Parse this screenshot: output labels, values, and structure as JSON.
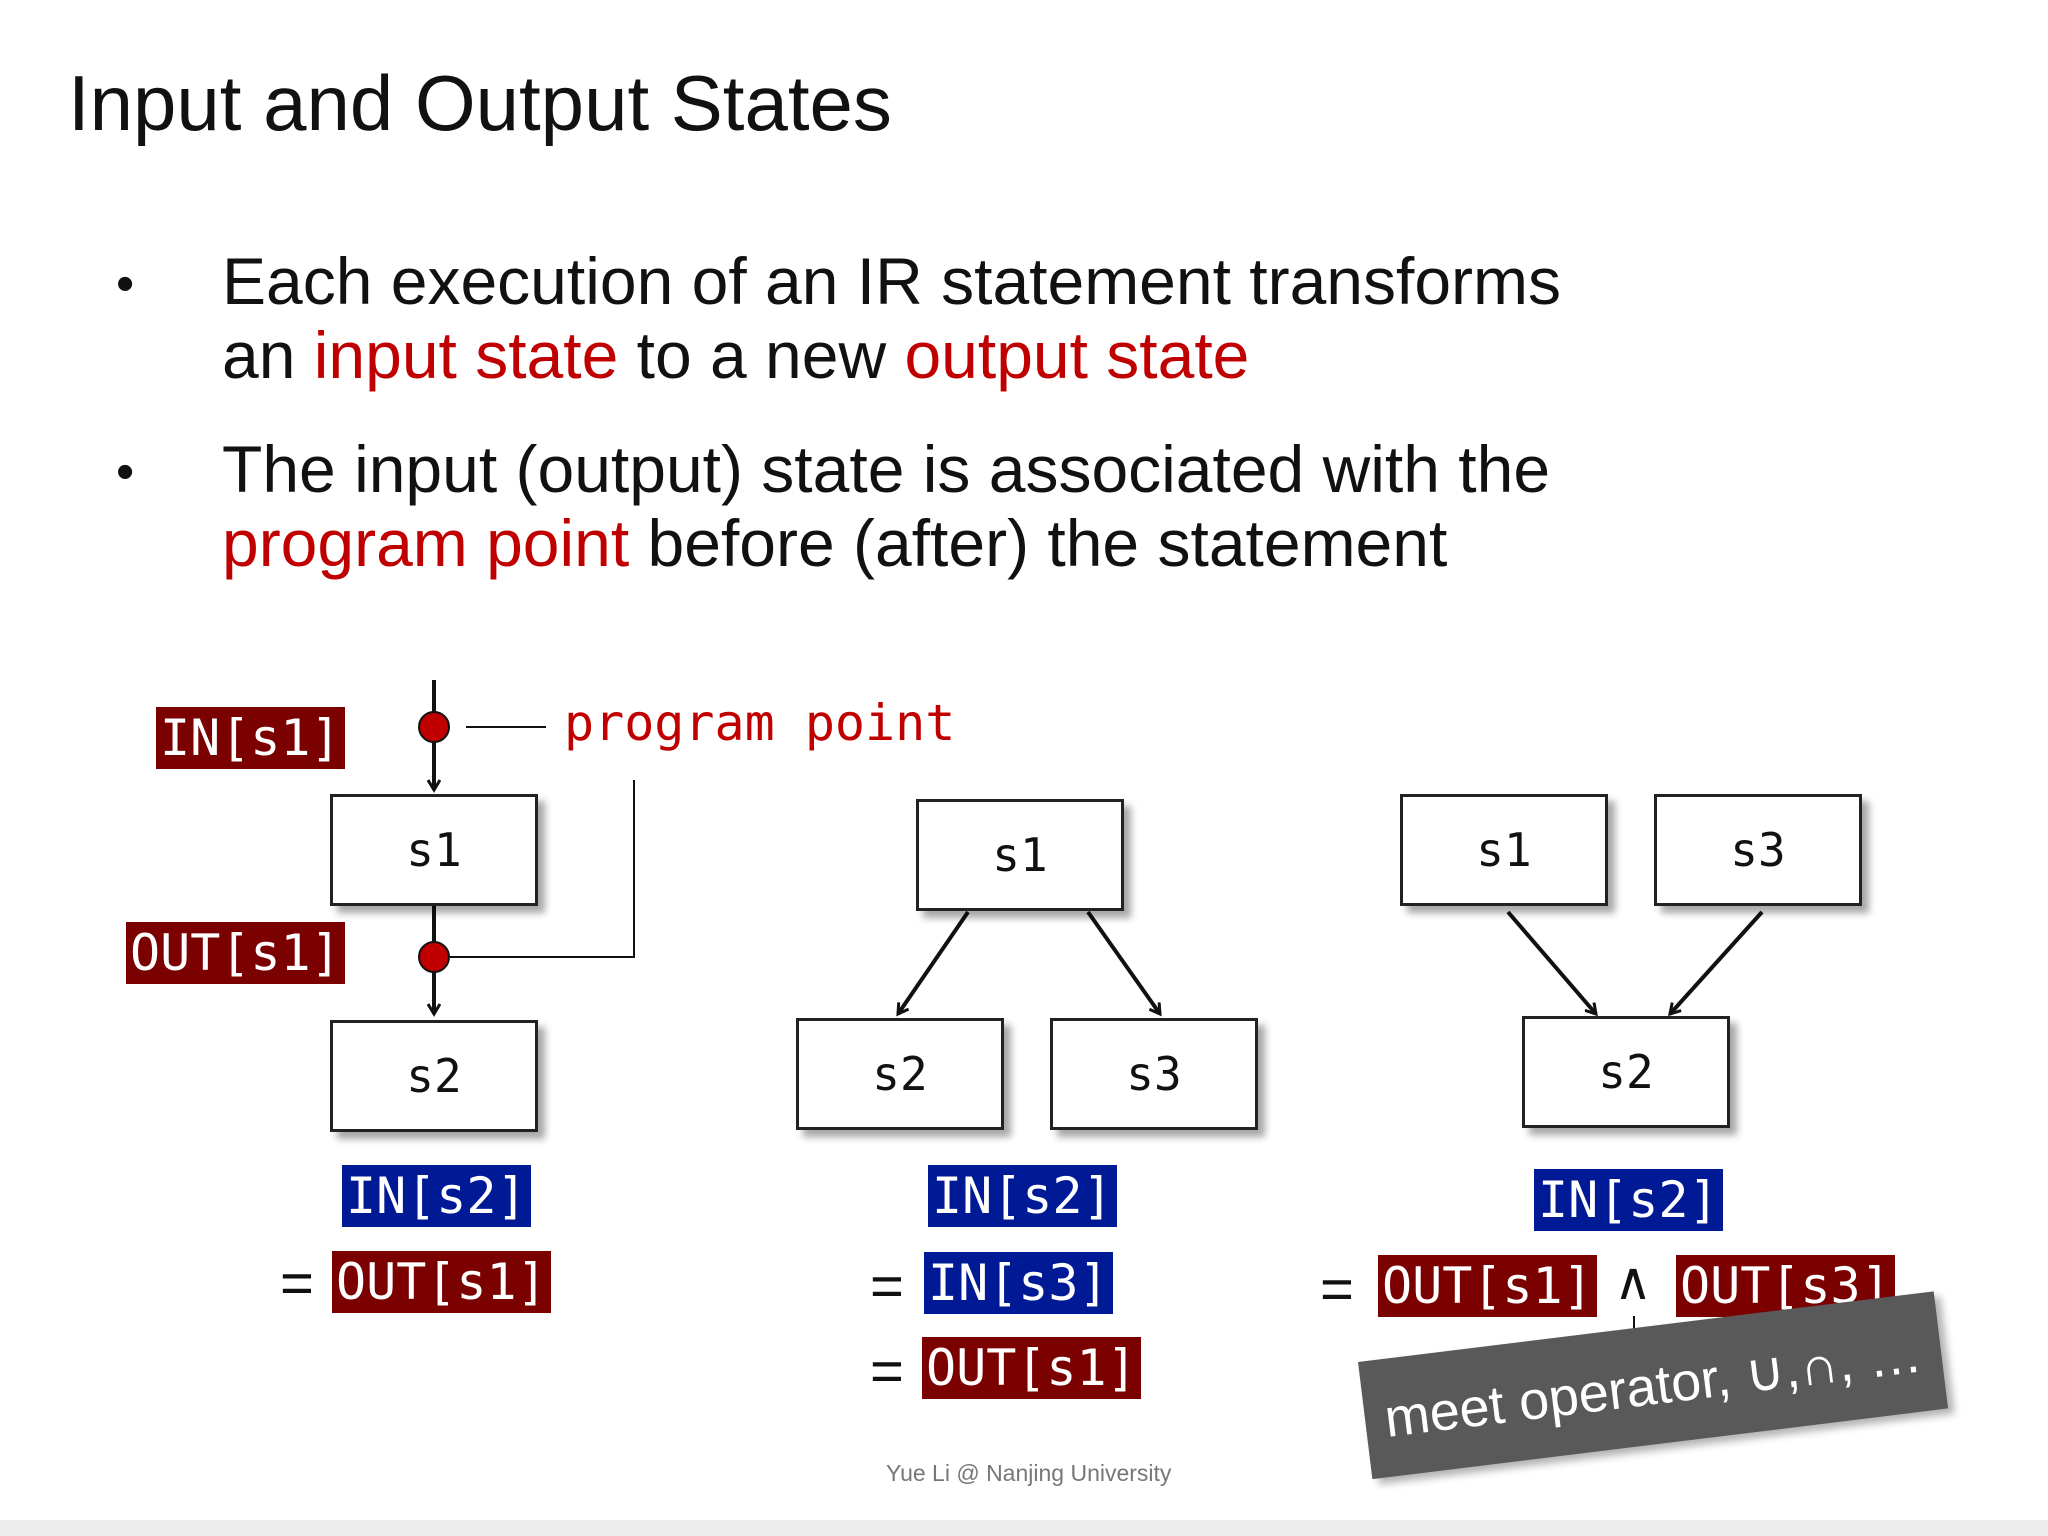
{
  "title": "Input and Output States",
  "bullets": [
    {
      "symbol": "•",
      "line1": "Each execution of an IR statement transforms",
      "line2_prefix": "an ",
      "line2_red1": "input state",
      "line2_mid": " to a new ",
      "line2_red2": "output state"
    },
    {
      "symbol": "•",
      "line1": "The input (output) state is associated with the",
      "line2_red": "program point",
      "line2_rest": " before (after) the statement"
    }
  ],
  "diagram_left": {
    "in_label": "IN[s1]",
    "out_label": "OUT[s1]",
    "program_point_label": "program point",
    "box_top": "s1",
    "box_bottom": "s2",
    "eq_lhs": "IN[s2]",
    "eq_sign": "=",
    "eq_rhs": "OUT[s1]"
  },
  "diagram_middle": {
    "box_top": "s1",
    "box_left": "s2",
    "box_right": "s3",
    "eq_lhs": "IN[s2]",
    "eq_sign": "=",
    "eq_rhs1": "IN[s3]",
    "eq_rhs2": "OUT[s1]"
  },
  "diagram_right": {
    "box_left": "s1",
    "box_right": "s3",
    "box_bottom": "s2",
    "eq_lhs": "IN[s2]",
    "eq_sign": "=",
    "eq_rhs1": "OUT[s1]",
    "meet_symbol": "∧",
    "eq_rhs2": "OUT[s3]",
    "callout": "meet operator, ∪,∩, …"
  },
  "footer": "Yue Li @ Nanjing University",
  "colors": {
    "red_text": "#c00000",
    "dark_red_tag": "#7b0000",
    "blue_tag": "#001a96",
    "callout_bg": "#595959"
  }
}
